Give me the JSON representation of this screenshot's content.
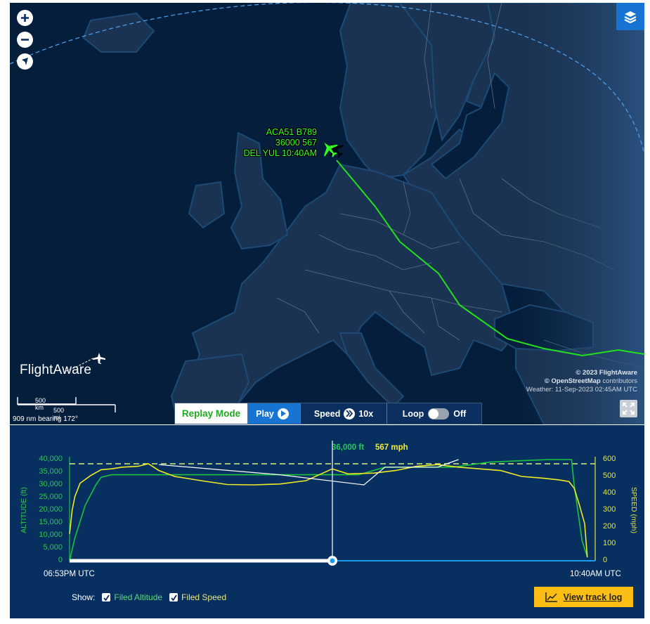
{
  "map": {
    "controls": {
      "zoom_in_icon": "plus-icon",
      "zoom_out_icon": "minus-icon",
      "north_icon": "compass-arrow-icon",
      "layers_icon": "layers-icon",
      "fullscreen_icon": "expand-icon"
    },
    "flight_label": {
      "line1": "ACA51 B789",
      "line2": "36000 567",
      "line3": "DEL YUL 10:40AM"
    },
    "logo": "FlightAware",
    "scale": {
      "km_label": "500 km",
      "mi_label": "500 mi",
      "bearing": "909 nm bearing 172°"
    },
    "attribution": {
      "line1": "© 2023 FlightAware",
      "line2_bold": "© OpenStreetMap",
      "line2_rest": " contributors",
      "line3": "Weather: 11-Sep-2023 02:45AM UTC"
    },
    "colors": {
      "route": "#22e01c",
      "aircraft": "#33ff22",
      "great_circle": "#4a9de8"
    }
  },
  "replay_controls": {
    "mode_label": "Replay Mode",
    "play_label": "Play",
    "speed_label": "Speed",
    "speed_value": "10x",
    "loop_label": "Loop",
    "loop_value": "Off"
  },
  "chart_data": {
    "type": "line",
    "title": "",
    "xlabel": "",
    "x_start_label": "06:53PM UTC",
    "x_end_label": "10:40AM UTC",
    "ylabel": "ALTITUDE (ft)",
    "ylabel_right": "SPEED (mph)",
    "ylim": [
      0,
      40000
    ],
    "ylim_right": [
      0,
      600
    ],
    "yticks": [
      "40,000",
      "35,000",
      "30,000",
      "25,000",
      "20,000",
      "15,000",
      "10,000",
      "5,000",
      "0"
    ],
    "yticks_right": [
      "600",
      "500",
      "400",
      "300",
      "200",
      "100",
      "0"
    ],
    "cursor": {
      "position": 0.5,
      "altitude_label": "36,000 ft",
      "speed_label": "567 mph"
    },
    "filed_speed_mph": 575,
    "progress": 0.5,
    "series": [
      {
        "name": "Altitude",
        "axis": "left",
        "color": "#19c43a",
        "x": [
          0,
          0.01,
          0.03,
          0.05,
          0.06,
          0.08,
          0.12,
          0.2,
          0.27,
          0.32,
          0.37,
          0.45,
          0.55,
          0.6,
          0.61,
          0.64,
          0.73,
          0.8,
          0.91,
          0.93,
          0.955,
          0.96,
          0.975,
          0.985
        ],
        "y": [
          0,
          9000,
          22000,
          30000,
          33000,
          34000,
          34000,
          34000,
          34000,
          34000,
          34000,
          34000,
          34000,
          37000,
          37000,
          37000,
          37000,
          39000,
          40000,
          40000,
          40000,
          30000,
          8000,
          1500
        ]
      },
      {
        "name": "Speed",
        "axis": "right",
        "color": "#f0ea22",
        "x": [
          0,
          0.005,
          0.01,
          0.02,
          0.04,
          0.06,
          0.08,
          0.1,
          0.13,
          0.15,
          0.17,
          0.2,
          0.25,
          0.3,
          0.35,
          0.4,
          0.45,
          0.5,
          0.53,
          0.58,
          0.62,
          0.66,
          0.7,
          0.74,
          0.78,
          0.82,
          0.86,
          0.9,
          0.93,
          0.95,
          0.96,
          0.97,
          0.98,
          0.985
        ],
        "y": [
          160,
          300,
          380,
          460,
          505,
          540,
          545,
          555,
          560,
          575,
          535,
          500,
          475,
          452,
          450,
          455,
          475,
          545,
          515,
          520,
          535,
          560,
          570,
          555,
          545,
          535,
          500,
          490,
          480,
          470,
          430,
          330,
          220,
          20
        ]
      },
      {
        "name": "Filed Altitude",
        "axis": "left",
        "color": "#ffffff",
        "x": [
          0.17,
          0.4,
          0.56,
          0.6,
          0.62,
          0.7,
          0.74
        ],
        "y": [
          38000,
          34000,
          30000,
          37000,
          37000,
          37000,
          40000
        ]
      }
    ],
    "legend": {
      "show_label": "Show:",
      "filed_altitude": "Filed Altitude",
      "filed_speed": "Filed Speed"
    },
    "grid": false
  },
  "track_log_button": {
    "label": "View track log",
    "icon": "chart-line-icon"
  }
}
